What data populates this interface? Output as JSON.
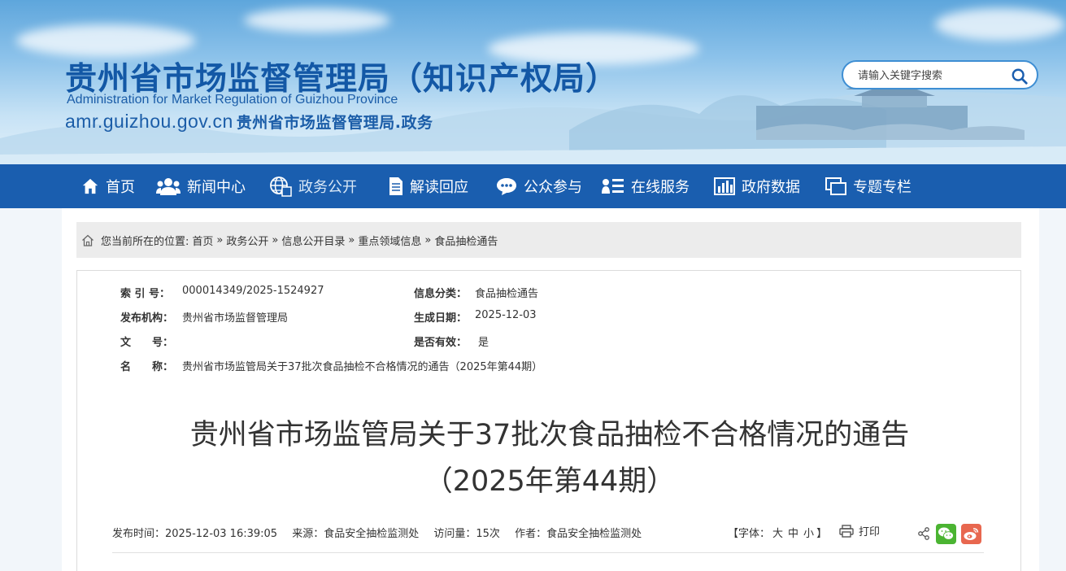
{
  "header": {
    "title": "贵州省市场监督管理局（知识产权局）",
    "title_en": "Administration for Market Regulation of Guizhou Province",
    "domain": "amr.guizhou.gov.cn",
    "domain_suffix": "贵州省市场监督管理局.政务",
    "search_placeholder": "请输入关键字搜索"
  },
  "nav": {
    "items": [
      {
        "label": "首页",
        "icon": "home-icon"
      },
      {
        "label": "新闻中心",
        "icon": "people-icon"
      },
      {
        "label": "政务公开",
        "icon": "globe-icon"
      },
      {
        "label": "解读回应",
        "icon": "document-icon"
      },
      {
        "label": "公众参与",
        "icon": "chat-icon"
      },
      {
        "label": "在线服务",
        "icon": "service-list-icon"
      },
      {
        "label": "政府数据",
        "icon": "bar-chart-icon"
      },
      {
        "label": "专题专栏",
        "icon": "window-icon"
      }
    ]
  },
  "breadcrumb": {
    "prefix": "您当前所在的位置:",
    "items": [
      "首页",
      "政务公开",
      "信息公开目录",
      "重点领域信息",
      "食品抽检通告"
    ],
    "separator": "»"
  },
  "meta": {
    "index_label": "索 引 号：",
    "index_value": "000014349/2025-1524927",
    "category_label": "信息分类：",
    "category_value": "食品抽检通告",
    "publisher_label": "发布机构：",
    "publisher_value": "贵州省市场监督管理局",
    "date_label": "生成日期：",
    "date_value": "2025-12-03",
    "docno_label": "文　　号：",
    "docno_value": "",
    "valid_label": "是否有效：",
    "valid_value": "是",
    "name_label": "名　　称：",
    "name_value": "贵州省市场监管局关于37批次食品抽检不合格情况的通告（2025年第44期）"
  },
  "article": {
    "title_line1": "贵州省市场监管局关于37批次食品抽检不合格情况的通告",
    "title_line2": "（2025年第44期）",
    "publish_time": "发布时间：2025-12-03 16:39:05",
    "source": "来源：食品安全抽检监测处",
    "visits": "访问量：15次",
    "author": "作者：食品安全抽检监测处",
    "fontsize_prefix": "【字体：",
    "fontsize_large": "大",
    "fontsize_medium": "中",
    "fontsize_small": "小",
    "fontsize_suffix": "】",
    "print_label": "打印"
  },
  "colors": {
    "nav_bg": "#1a5eaf",
    "title_blue": "#1358a6",
    "breadcrumb_bg": "#ececec",
    "wechat": "#4bb432",
    "weibo": "#e8674f"
  }
}
